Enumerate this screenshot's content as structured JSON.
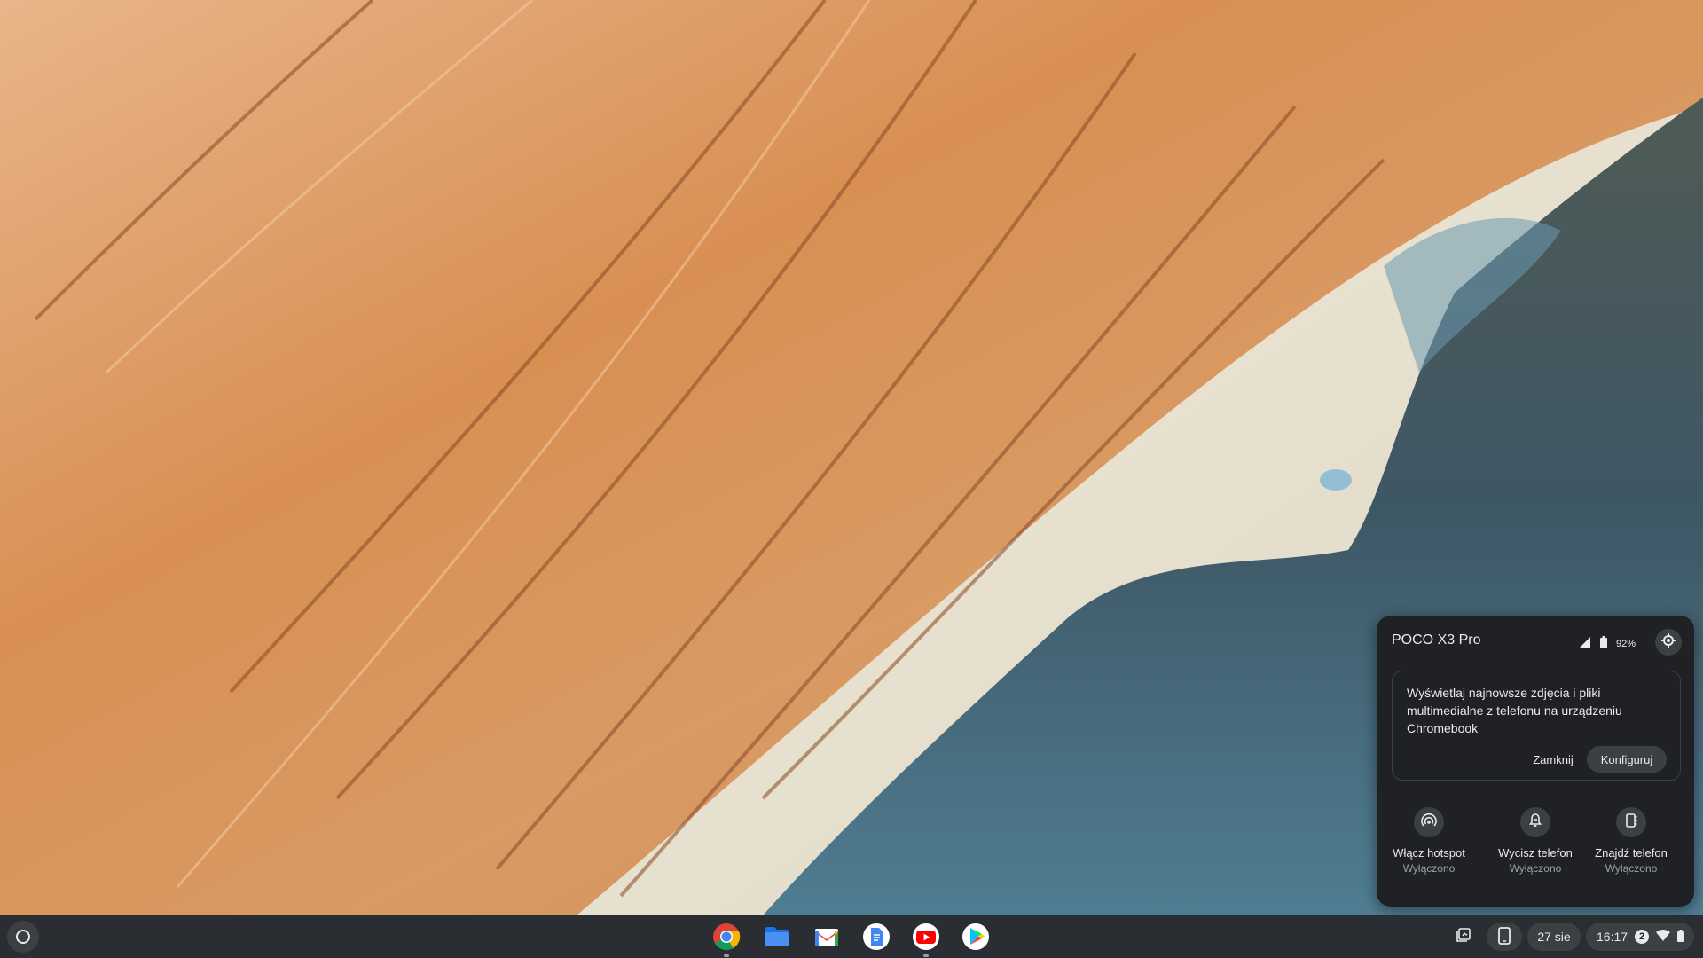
{
  "phone_hub": {
    "device_name": "POCO X3 Pro",
    "battery": "92%",
    "promo": {
      "text": "Wyświetlaj najnowsze zdjęcia i pliki multimedialne z telefonu na urządzeniu Chromebook",
      "dismiss_label": "Zamknij",
      "setup_label": "Konfiguruj"
    },
    "features": [
      {
        "label": "Włącz hotspot",
        "state": "Wyłączono",
        "icon": "hotspot-icon"
      },
      {
        "label": "Wycisz telefon",
        "state": "Wyłączono",
        "icon": "silence-icon"
      },
      {
        "label": "Znajdź telefon",
        "state": "Wyłączono",
        "icon": "find-phone-icon"
      }
    ]
  },
  "shelf": {
    "apps": [
      {
        "name": "chrome",
        "icon": "chrome-icon"
      },
      {
        "name": "files",
        "icon": "files-icon"
      },
      {
        "name": "gmail",
        "icon": "gmail-icon"
      },
      {
        "name": "docs",
        "icon": "docs-icon"
      },
      {
        "name": "youtube",
        "icon": "youtube-icon"
      },
      {
        "name": "play-store",
        "icon": "play-store-icon"
      }
    ],
    "date": "27 sie",
    "time": "16:17",
    "notification_count": "2"
  },
  "colors": {
    "panel_bg": "#202124",
    "shelf_bg": "#2a2d31",
    "pill_bg": "#3c4043"
  }
}
